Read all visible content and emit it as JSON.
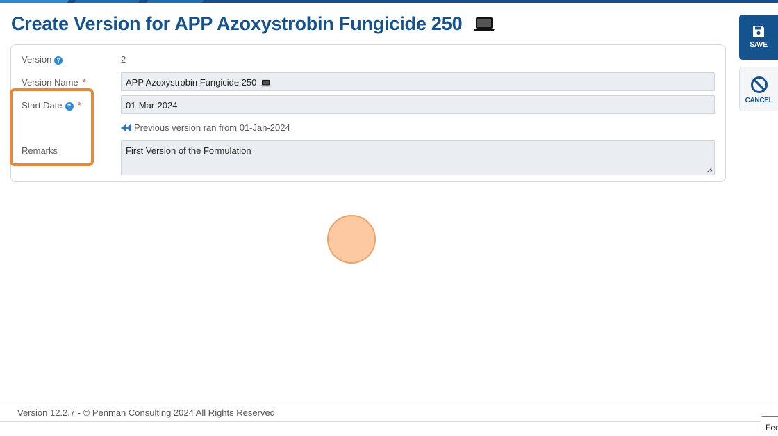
{
  "header": {
    "title": "Create Version for APP Azoxystrobin Fungicide 250",
    "title_icon": "laptop-icon"
  },
  "form": {
    "version": {
      "label": "Version",
      "value": "2"
    },
    "version_name": {
      "label": "Version Name",
      "required_mark": "*",
      "value": "APP Azoxystrobin Fungicide 250",
      "value_icon": "laptop-icon"
    },
    "start_date": {
      "label": "Start Date",
      "required_mark": "*",
      "value": "01-Mar-2024"
    },
    "previous_note": "Previous version ran from 01-Jan-2024",
    "remarks": {
      "label": "Remarks",
      "value": "First Version of the Formulation"
    },
    "help_glyph": "?"
  },
  "actions": {
    "save_label": "SAVE",
    "cancel_label": "CANCEL"
  },
  "footer": {
    "text": "Version 12.2.7 - © Penman Consulting 2024 All Rights Reserved",
    "feedback_label": "Feedback"
  },
  "colors": {
    "brand_blue": "#14538d",
    "accent_blue": "#2a8ad6",
    "highlight_orange": "#e8893a",
    "required_red": "#d0342c",
    "field_bg": "#eaeef3"
  }
}
